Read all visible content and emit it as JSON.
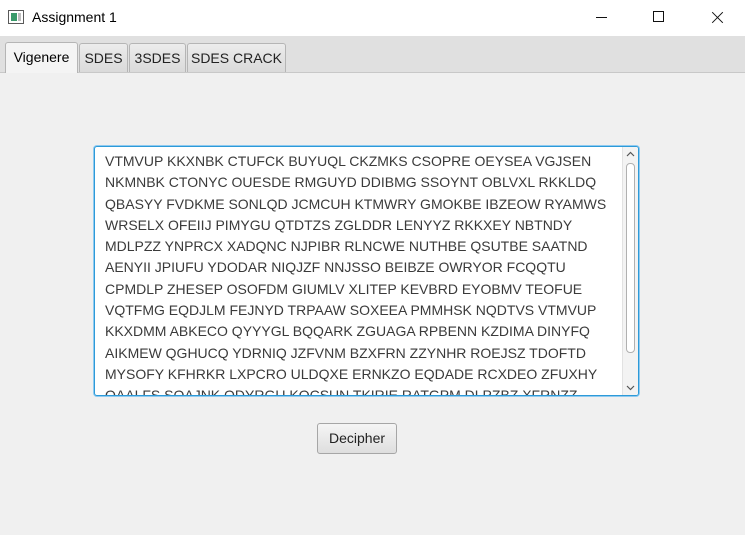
{
  "window": {
    "title": "Assignment 1",
    "controls": [
      "minimize",
      "maximize",
      "close"
    ]
  },
  "tabs": [
    {
      "label": "Vigenere",
      "active": true
    },
    {
      "label": "SDES",
      "active": false
    },
    {
      "label": "3SDES",
      "active": false
    },
    {
      "label": "SDES CRACK",
      "active": false
    }
  ],
  "main": {
    "ciphertext": "VTMVUP KKXNBK CTUFCK BUYUQL CKZMKS CSOPRE OEYSEA VGJSEN\nNKMNBK CTONYC OUESDE RMGUYD DDIBMG SSOYNT OBLVXL RKKLDQ\nQBASYY FVDKME SONLQD JCMCUH KTMWRY GMOKBE IBZEOW RYAMWS\nWRSELX OFEIIJ PIMYGU QTDTZS ZGLDDR LENYYZ RKKXEY NBTNDY\nMDLPZZ YNPRCX XADQNC NJPIBR RLNCWE NUTHBE QSUTBE SAATND\nAENYII JPIUFU YDODAR NIQJZF NNJSSO BEIBZE OWRYOR FCQQTU\nCPMDLP ZHESEP OSOFDM GIUMLV XLITEP KEVBRD EYOBMV TEOFUE\nVQTFMG EQDJLM FEJNYD TRPAAW SOXEEA PMMHSK NQDTVS VTMVUP\nKKXDMM ABKECO QYYYGL BQQARK ZGUAGA RPBENN KZDIMA DINYFQ\nAIKMEW QGHUCQ YDRNIQ JZFVNM BZXFRN ZZYNHR ROEJSZ TDOFTD\nMYSOFY KFHRKR LXPCRO ULDQXE ERNKZO EQDADE RCXDEO ZFUXHY\nQAALFS SOAJNK ODYRGU KQCSUN TKIRIE RATGPM DLPZBZ XFRNZZ",
    "decipher_label": "Decipher"
  },
  "colors": {
    "focus_border": "#2d9ad8",
    "background": "#f0f0f0",
    "tabbar": "#e0e0e0"
  }
}
